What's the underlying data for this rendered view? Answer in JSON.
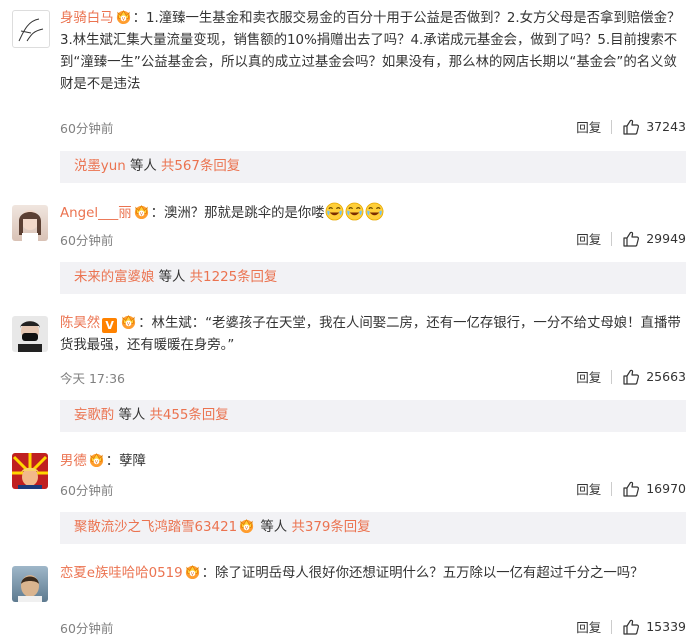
{
  "comments": [
    {
      "user": "身骑白马",
      "text": "：1.潼臻一生基金和卖衣服交易金的百分十用于公益是否做到？2.女方父母是否拿到赔偿金？3.林生斌汇集大量流量变现，销售额的10%捐赠出去了吗？4.承诺成元基金会，做到了吗？5.目前搜索不到“潼臻一生”公益基金会，所以真的成立过基金会吗？如果没有，那么林的网店长期以“基金会”的名义敛财是不是违法",
      "time": "60分钟前",
      "reply_label": "回复",
      "likes": "37243",
      "reply_box": {
        "who": "涚墨yun",
        "mid": "等人",
        "total": "共567条回复"
      }
    },
    {
      "user": "Angel___丽",
      "text": "：澳洲？那就是跳伞的是你喽",
      "time": "60分钟前",
      "reply_label": "回复",
      "likes": "29949",
      "reply_box": {
        "who": "未来的富婆娘",
        "mid": "等人",
        "total": "共1225条回复"
      }
    },
    {
      "user": "陈昊然",
      "text": "：林生斌：“老婆孩子在天堂，我在人间娶二房，还有一亿存银行，一分不给丈母娘！直播带货我最强，还有暖暖在身旁。”",
      "time": "今天 17:36",
      "reply_label": "回复",
      "likes": "25663",
      "reply_box": {
        "who": "妄歌酌",
        "mid": "等人",
        "total": "共455条回复"
      }
    },
    {
      "user": "男德",
      "text": "：孽障",
      "time": "60分钟前",
      "reply_label": "回复",
      "likes": "16970",
      "reply_box": {
        "who": "聚散流沙之飞鸿踏雪63421",
        "mid": "等人",
        "total": "共379条回复"
      }
    },
    {
      "user": "恋夏e族哇哈哈0519",
      "text": "：除了证明岳母人很好你还想证明什么？五万除以一亿有超过千分之一吗？",
      "time": "60分钟前",
      "reply_label": "回复",
      "likes": "15339"
    }
  ],
  "colors": {
    "username": "#eb7350",
    "reply_bg": "#f2f2f5",
    "muted": "#808080"
  },
  "icons": [
    "vip-crown-badge-icon",
    "verified-v-icon",
    "thumbs-up-icon",
    "crying-laugh-emoji-icon"
  ]
}
